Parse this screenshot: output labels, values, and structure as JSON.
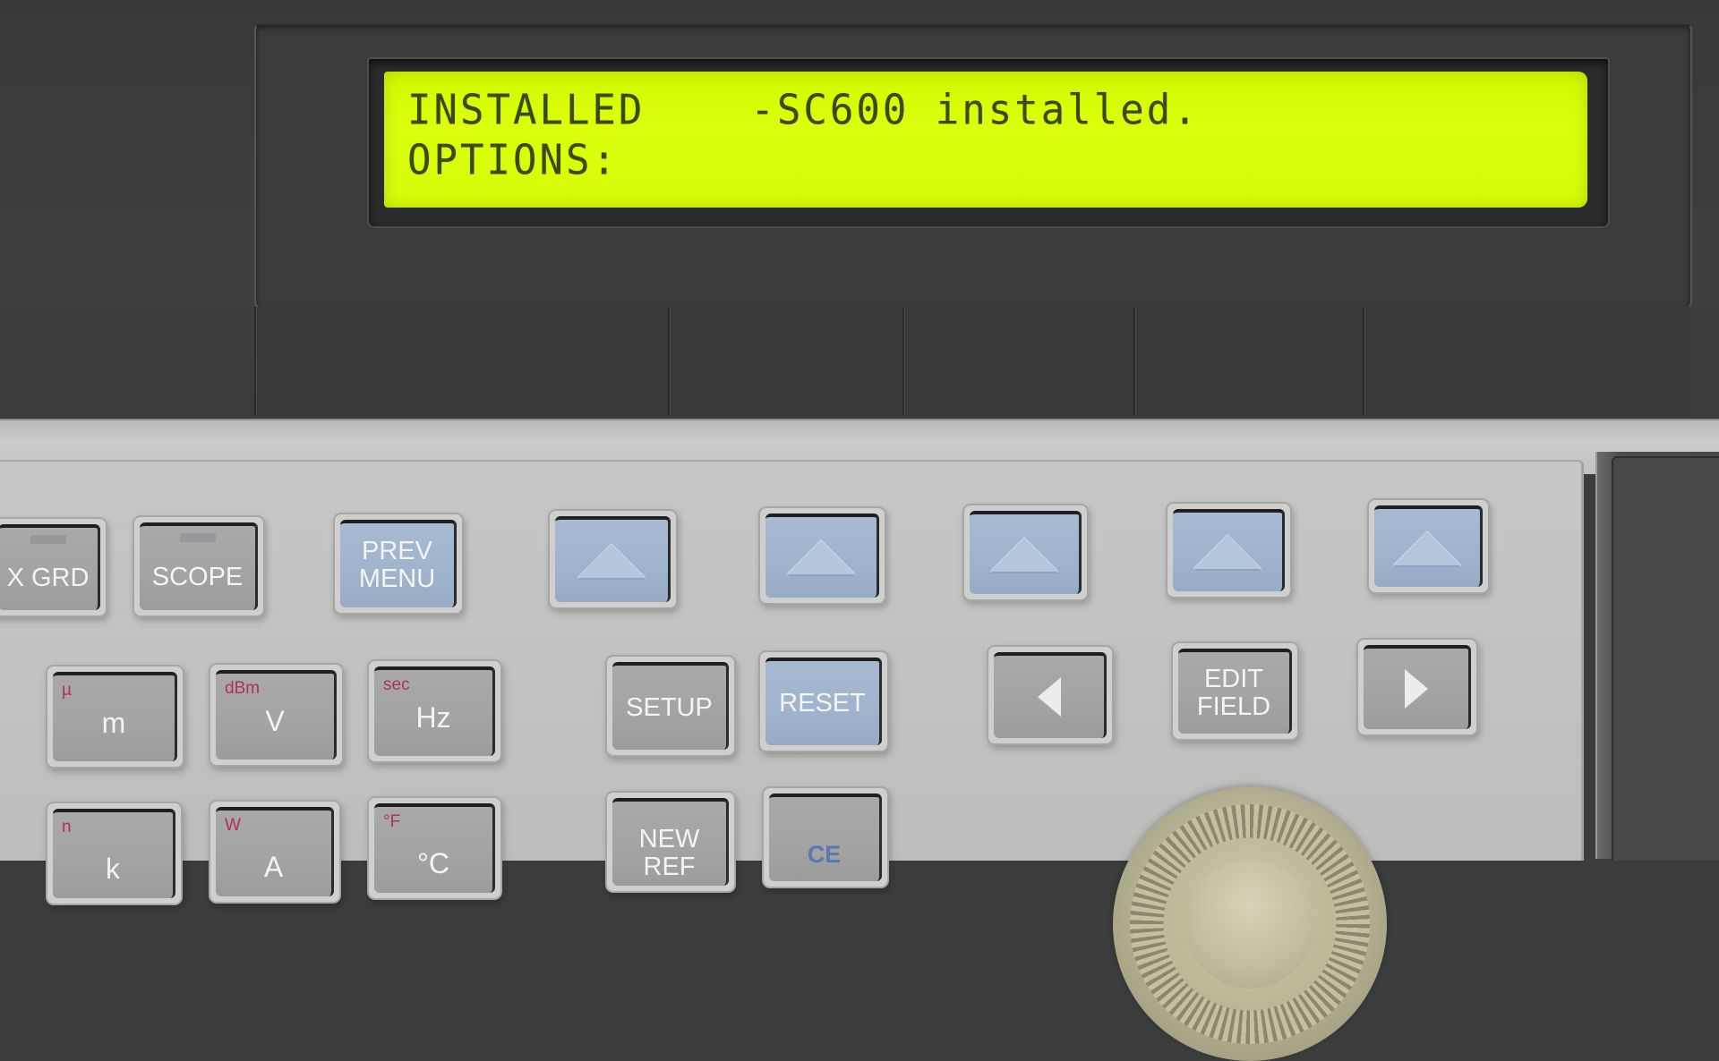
{
  "display": {
    "line1": "INSTALLED    -SC600 installed.",
    "line2": "OPTIONS:",
    "backlight_color": "#d8fb08",
    "text_color": "#3a4a10"
  },
  "softkeys": {
    "count": 5,
    "icon": "up-triangle-icon"
  },
  "keys": {
    "row1": [
      {
        "id": "x-grd",
        "label": "X GRD",
        "color": "gray",
        "led": true
      },
      {
        "id": "scope",
        "label": "SCOPE",
        "color": "gray",
        "led": true
      },
      {
        "id": "prev-menu",
        "label": "PREV\nMENU",
        "line1": "PREV",
        "line2": "MENU",
        "color": "blue"
      }
    ],
    "row2": [
      {
        "id": "m",
        "label": "m",
        "shift": "µ"
      },
      {
        "id": "v",
        "label": "V",
        "shift": "dBm"
      },
      {
        "id": "hz",
        "label": "Hz",
        "shift": "sec"
      },
      {
        "id": "setup",
        "label": "SETUP"
      },
      {
        "id": "reset",
        "label": "RESET",
        "color": "blue"
      },
      {
        "id": "cursor-left",
        "icon": "left-triangle-icon"
      },
      {
        "id": "edit-field",
        "line1": "EDIT",
        "line2": "FIELD"
      },
      {
        "id": "cursor-right",
        "icon": "right-triangle-icon"
      }
    ],
    "row3": [
      {
        "id": "k",
        "label": "k",
        "shift": "n"
      },
      {
        "id": "a",
        "label": "A",
        "shift": "W"
      },
      {
        "id": "deg-c",
        "label": "°C",
        "shift": "°F"
      },
      {
        "id": "new-ref",
        "line1": "NEW",
        "line2": "REF"
      },
      {
        "id": "ce",
        "label": "CE"
      }
    ]
  },
  "colors": {
    "key_gray": "#a3a3a2",
    "key_blue": "#a0b3cc",
    "shift_label": "#b0305a",
    "panel_dark": "#3b3d3c",
    "panel_light": "#c4c4c2"
  }
}
